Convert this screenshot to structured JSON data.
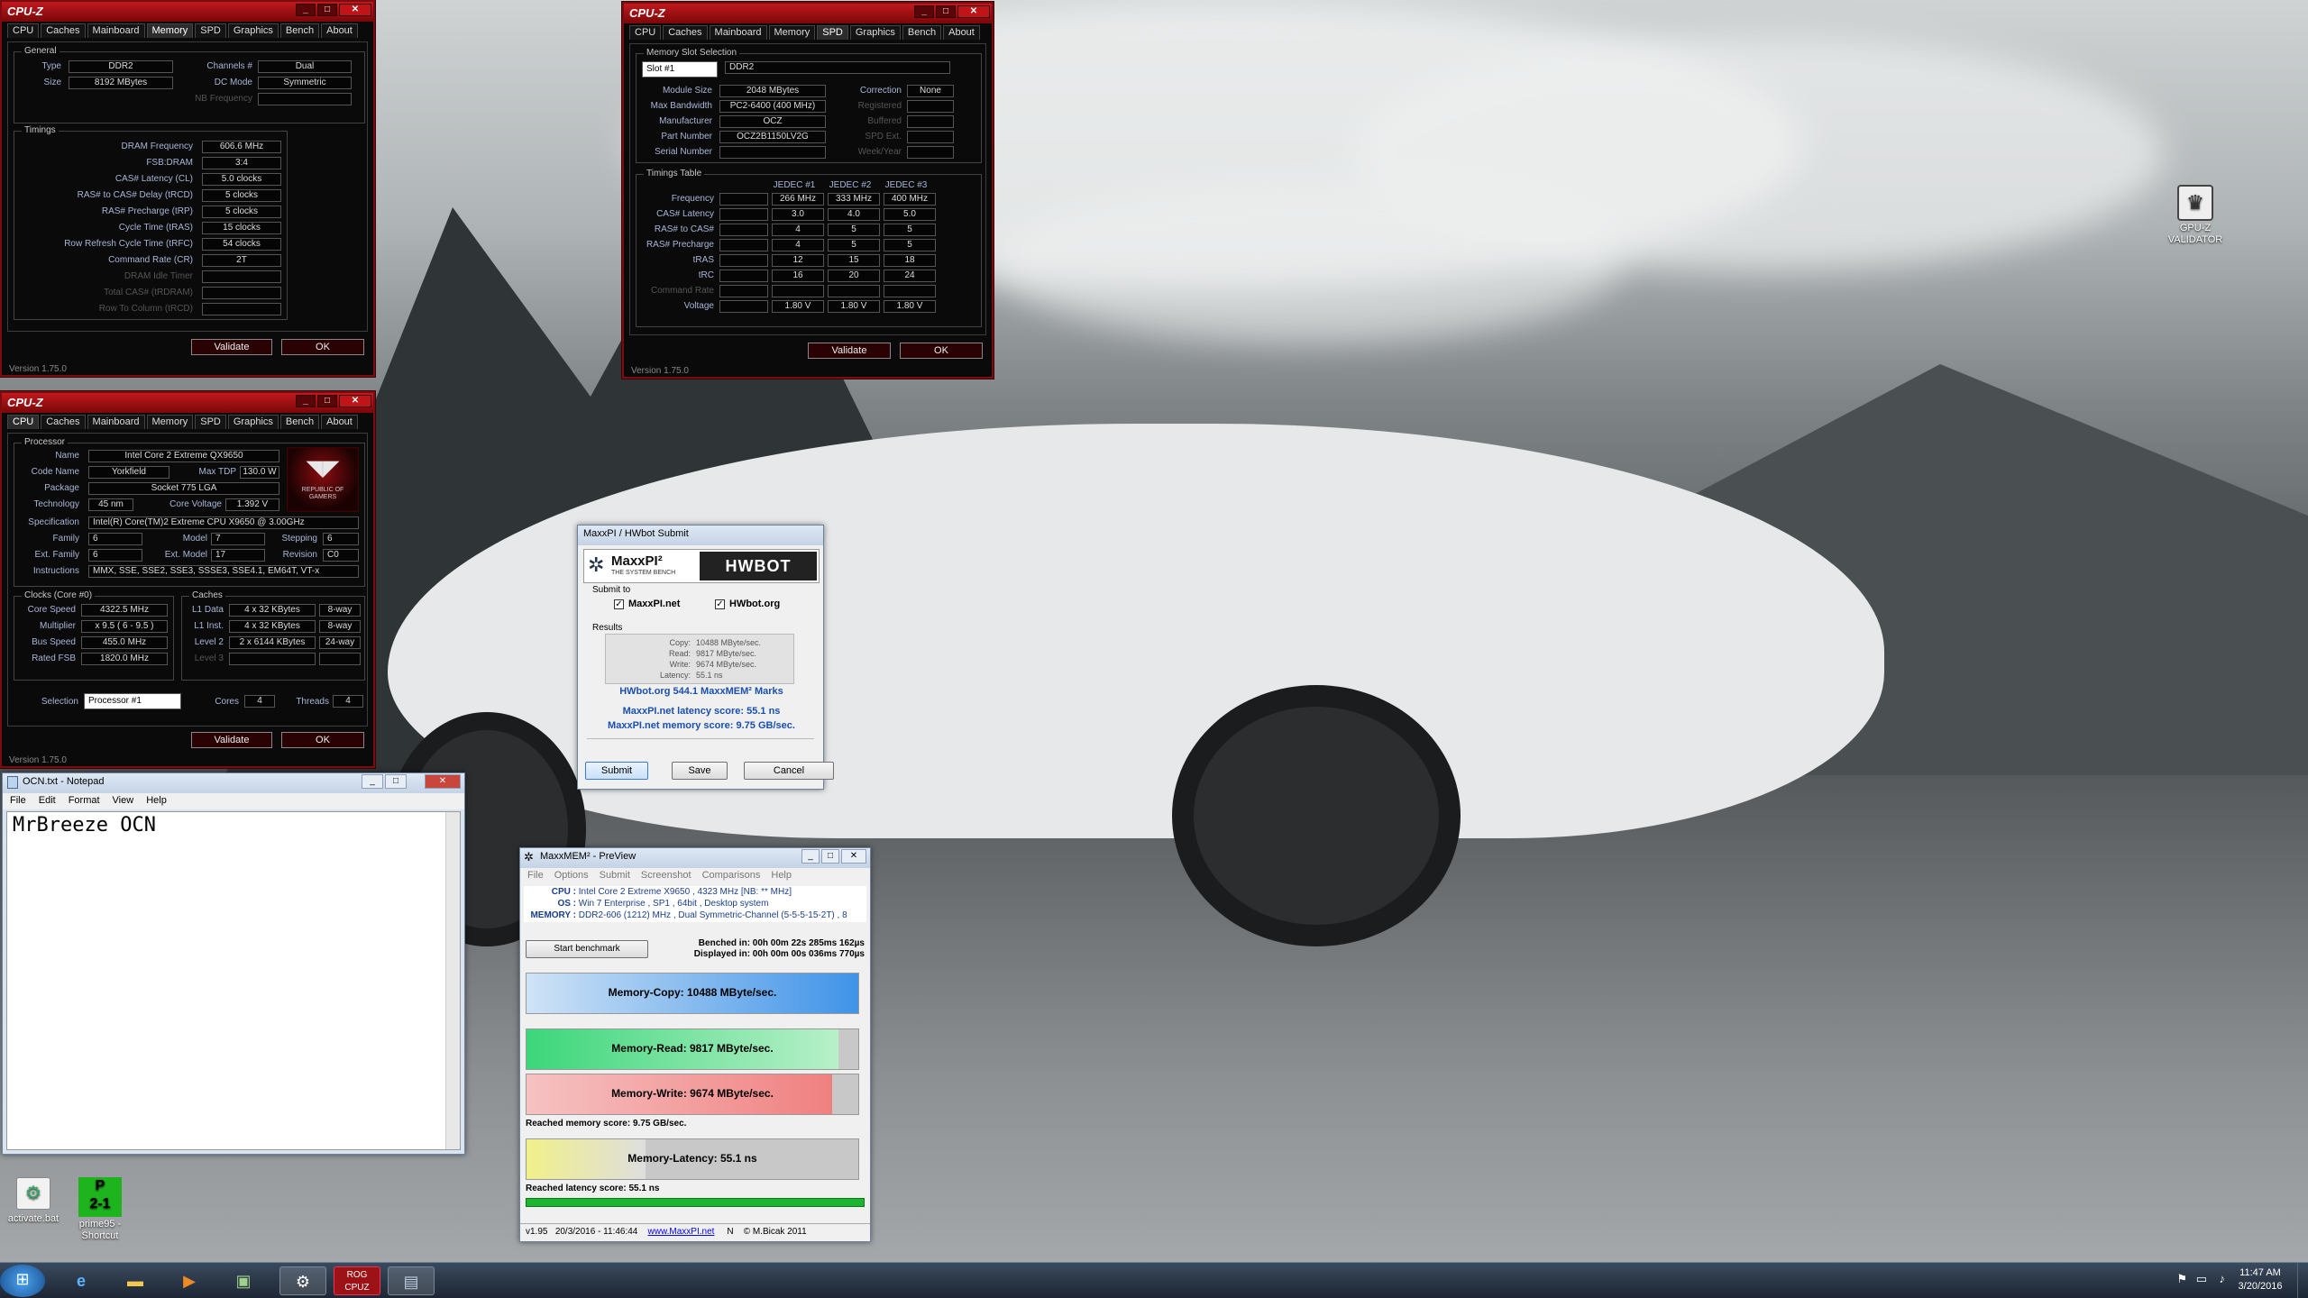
{
  "desktop": {
    "icons": [
      {
        "label": "GPU-Z VALIDATOR"
      },
      {
        "label": "activate.bat"
      },
      {
        "label": "prime95 - Shortcut"
      }
    ]
  },
  "cpuz_memory": {
    "title": "CPU-Z",
    "tabs": [
      "CPU",
      "Caches",
      "Mainboard",
      "Memory",
      "SPD",
      "Graphics",
      "Bench",
      "About"
    ],
    "active_tab": "Memory",
    "general_label": "General",
    "type_label": "Type",
    "type": "DDR2",
    "size_label": "Size",
    "size": "8192 MBytes",
    "channels_label": "Channels #",
    "channels": "Dual",
    "dcmode_label": "DC Mode",
    "dcmode": "Symmetric",
    "nbfreq_label": "NB Frequency",
    "timings_label": "Timings",
    "timings": [
      {
        "k": "DRAM Frequency",
        "v": "606.6 MHz"
      },
      {
        "k": "FSB:DRAM",
        "v": "3:4"
      },
      {
        "k": "CAS# Latency (CL)",
        "v": "5.0 clocks"
      },
      {
        "k": "RAS# to CAS# Delay (tRCD)",
        "v": "5 clocks"
      },
      {
        "k": "RAS# Precharge (tRP)",
        "v": "5 clocks"
      },
      {
        "k": "Cycle Time (tRAS)",
        "v": "15 clocks"
      },
      {
        "k": "Row Refresh Cycle Time (tRFC)",
        "v": "54 clocks"
      },
      {
        "k": "Command Rate (CR)",
        "v": "2T"
      },
      {
        "k": "DRAM Idle Timer",
        "v": ""
      },
      {
        "k": "Total CAS# (tRDRAM)",
        "v": ""
      },
      {
        "k": "Row To Column (tRCD)",
        "v": ""
      }
    ],
    "validate": "Validate",
    "ok": "OK",
    "version": "Version 1.75.0"
  },
  "cpuz_spd": {
    "title": "CPU-Z",
    "active_tab": "SPD",
    "slot_group": "Memory Slot Selection",
    "slot": "Slot #1",
    "slot_type": "DDR2",
    "rows": [
      {
        "k": "Module Size",
        "v": "2048 MBytes",
        "k2": "Correction",
        "v2": "None"
      },
      {
        "k": "Max Bandwidth",
        "v": "PC2-6400 (400 MHz)",
        "k2": "Registered",
        "v2": ""
      },
      {
        "k": "Manufacturer",
        "v": "OCZ",
        "k2": "Buffered",
        "v2": ""
      },
      {
        "k": "Part Number",
        "v": "OCZ2B1150LV2G",
        "k2": "SPD Ext.",
        "v2": ""
      },
      {
        "k": "Serial Number",
        "v": "",
        "k2": "Week/Year",
        "v2": ""
      }
    ],
    "timings_group": "Timings Table",
    "jedec_headers": [
      "JEDEC #1",
      "JEDEC #2",
      "JEDEC #3"
    ],
    "table": [
      {
        "k": "Frequency",
        "v": [
          "266 MHz",
          "333 MHz",
          "400 MHz"
        ]
      },
      {
        "k": "CAS# Latency",
        "v": [
          "3.0",
          "4.0",
          "5.0"
        ]
      },
      {
        "k": "RAS# to CAS#",
        "v": [
          "4",
          "5",
          "5"
        ]
      },
      {
        "k": "RAS# Precharge",
        "v": [
          "4",
          "5",
          "5"
        ]
      },
      {
        "k": "tRAS",
        "v": [
          "12",
          "15",
          "18"
        ]
      },
      {
        "k": "tRC",
        "v": [
          "16",
          "20",
          "24"
        ]
      },
      {
        "k": "Command Rate",
        "v": [
          "",
          "",
          ""
        ]
      },
      {
        "k": "Voltage",
        "v": [
          "1.80 V",
          "1.80 V",
          "1.80 V"
        ]
      }
    ],
    "validate": "Validate",
    "ok": "OK",
    "version": "Version 1.75.0"
  },
  "cpuz_cpu": {
    "title": "CPU-Z",
    "active_tab": "CPU",
    "processor_group": "Processor",
    "name_label": "Name",
    "name": "Intel Core 2 Extreme QX9650",
    "codename_label": "Code Name",
    "codename": "Yorkfield",
    "maxtdp_label": "Max TDP",
    "maxtdp": "130.0 W",
    "package_label": "Package",
    "package": "Socket 775 LGA",
    "tech_label": "Technology",
    "tech": "45 nm",
    "corev_label": "Core Voltage",
    "corev": "1.392 V",
    "spec_label": "Specification",
    "spec": "Intel(R) Core(TM)2 Extreme CPU X9650  @ 3.00GHz",
    "family_label": "Family",
    "family": "6",
    "model_label": "Model",
    "model": "7",
    "stepping_label": "Stepping",
    "stepping": "6",
    "extfamily_label": "Ext. Family",
    "extfamily": "6",
    "extmodel_label": "Ext. Model",
    "extmodel": "17",
    "revision_label": "Revision",
    "revision": "C0",
    "instr_label": "Instructions",
    "instr": "MMX, SSE, SSE2, SSE3, SSSE3, SSE4.1, EM64T, VT-x",
    "logo_text": "REPUBLIC OF GAMERS",
    "clocks_group": "Clocks (Core #0)",
    "clocks": [
      {
        "k": "Core Speed",
        "v": "4322.5 MHz"
      },
      {
        "k": "Multiplier",
        "v": "x 9.5 ( 6 - 9.5 )"
      },
      {
        "k": "Bus Speed",
        "v": "455.0 MHz"
      },
      {
        "k": "Rated FSB",
        "v": "1820.0 MHz"
      }
    ],
    "caches_group": "Caches",
    "caches": [
      {
        "k": "L1 Data",
        "v": "4 x 32 KBytes",
        "w": "8-way"
      },
      {
        "k": "L1 Inst.",
        "v": "4 x 32 KBytes",
        "w": "8-way"
      },
      {
        "k": "Level 2",
        "v": "2 x 6144 KBytes",
        "w": "24-way"
      },
      {
        "k": "Level 3",
        "v": "",
        "w": ""
      }
    ],
    "selection_label": "Selection",
    "selection": "Processor #1",
    "cores_label": "Cores",
    "cores": "4",
    "threads_label": "Threads",
    "threads": "4",
    "validate": "Validate",
    "ok": "OK",
    "version": "Version 1.75.0"
  },
  "notepad": {
    "title": "OCN.txt - Notepad",
    "menu": [
      "File",
      "Edit",
      "Format",
      "View",
      "Help"
    ],
    "content": "MrBreeze OCN"
  },
  "hwbot": {
    "title": "MaxxPI / HWbot Submit",
    "maxxpi_logo": "MaxxPI²",
    "maxxpi_sub": "THE SYSTEM BENCH",
    "hwbot_logo": "HWBOT",
    "submit_to": "Submit to",
    "opt1": "MaxxPI.net",
    "opt2": "HWbot.org",
    "results": "Results",
    "res": [
      {
        "k": "Copy:",
        "v": "10488 MByte/sec."
      },
      {
        "k": "Read:",
        "v": "9817 MByte/sec."
      },
      {
        "k": "Write:",
        "v": "9674 MByte/sec."
      },
      {
        "k": "Latency:",
        "v": "55.1 ns"
      }
    ],
    "hwbot_line": "HWbot.org  544.1  MaxxMEM² Marks",
    "lat_line": "MaxxPI.net latency score:  55.1 ns",
    "mem_line": "MaxxPI.net memory score:  9.75 GB/sec.",
    "submit": "Submit",
    "save": "Save",
    "cancel": "Cancel"
  },
  "maxxmem": {
    "title": "MaxxMEM² - PreView",
    "menu": [
      "File",
      "Options",
      "Submit",
      "Screenshot",
      "Comparisons",
      "Help"
    ],
    "cpu_label": "CPU :",
    "cpu": "Intel Core 2 Extreme X9650 , 4323 MHz  [NB: ** MHz]",
    "os_label": "OS :",
    "os": "Win 7 Enterprise , SP1 , 64bit , Desktop system",
    "mem_label": "MEMORY :",
    "mem": "DDR2-606 (1212) MHz , Dual Symmetric-Channel (5-5-5-15-2T) , 8",
    "start": "Start benchmark",
    "benched": "Benched in: 00h 00m 22s 285ms 162µs",
    "displayed": "Displayed in: 00h 00m 00s 036ms 770µs",
    "copy": "Memory-Copy: 10488 MByte/sec.",
    "read": "Memory-Read: 9817 MByte/sec.",
    "write": "Memory-Write: 9674 MByte/sec.",
    "mem_score": "Reached memory score: 9.75 GB/sec.",
    "latency": "Memory-Latency: 55.1 ns",
    "lat_score": "Reached latency score: 55.1 ns",
    "fill": {
      "copy": 1.0,
      "read": 0.94,
      "write": 0.92,
      "latency": 0.36
    },
    "status_ver": "v1.95",
    "status_date": "20/3/2016 - 11:46:44",
    "status_url": "www.MaxxPI.net",
    "status_n": "N",
    "status_copy": "© M.Bicak 2011"
  },
  "taskbar": {
    "time": "11:47 AM",
    "date": "3/20/2016"
  }
}
